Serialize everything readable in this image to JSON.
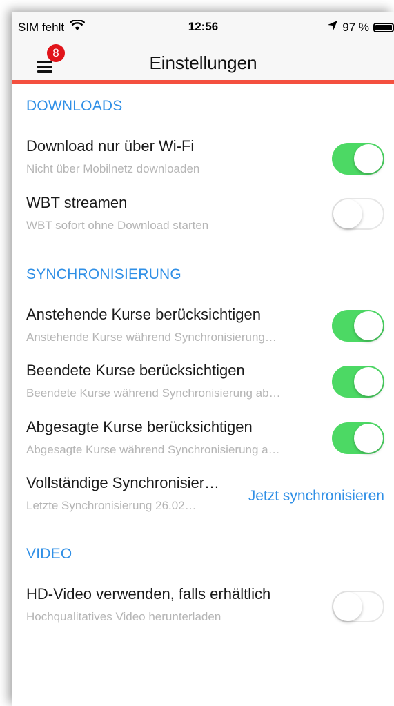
{
  "status_bar": {
    "carrier": "SIM fehlt",
    "time": "12:56",
    "battery": "97 %",
    "icons": [
      "wifi-icon",
      "location-arrow-icon",
      "battery-icon"
    ]
  },
  "nav": {
    "title": "Einstellungen",
    "menu_badge": "8",
    "accent": "#f4503f"
  },
  "sections": {
    "downloads": {
      "title": "DOWNLOADS",
      "rows": [
        {
          "title": "Download nur über Wi-Fi",
          "subtitle": "Nicht über Mobilnetz downloaden",
          "on": true
        },
        {
          "title": "WBT streamen",
          "subtitle": "WBT sofort ohne Download starten",
          "on": false
        }
      ]
    },
    "sync": {
      "title": "SYNCHRONISIERUNG",
      "rows": [
        {
          "title": "Anstehende Kurse berücksichtigen",
          "subtitle": "Anstehende Kurse während Synchronisierung…",
          "on": true
        },
        {
          "title": "Beendete Kurse berücksichtigen",
          "subtitle": "Beendete Kurse während Synchronisierung ab…",
          "on": true
        },
        {
          "title": "Abgesagte Kurse berücksichtigen",
          "subtitle": "Abgesagte Kurse während Synchronisierung a…",
          "on": true
        }
      ],
      "full_sync": {
        "title": "Vollständige Synchronisier…",
        "subtitle": "Letzte Synchronisierung 26.02…",
        "action": "Jetzt synchronisieren"
      }
    },
    "video": {
      "title": "VIDEO",
      "rows": [
        {
          "title": "HD-Video verwenden, falls erhältlich",
          "subtitle": "Hochqualitatives Video herunterladen",
          "on": false
        }
      ]
    }
  },
  "colors": {
    "toggle_on": "#4cd964",
    "section_title": "#2f8fe6",
    "link": "#2f8fe6",
    "badge": "#e1141a"
  }
}
